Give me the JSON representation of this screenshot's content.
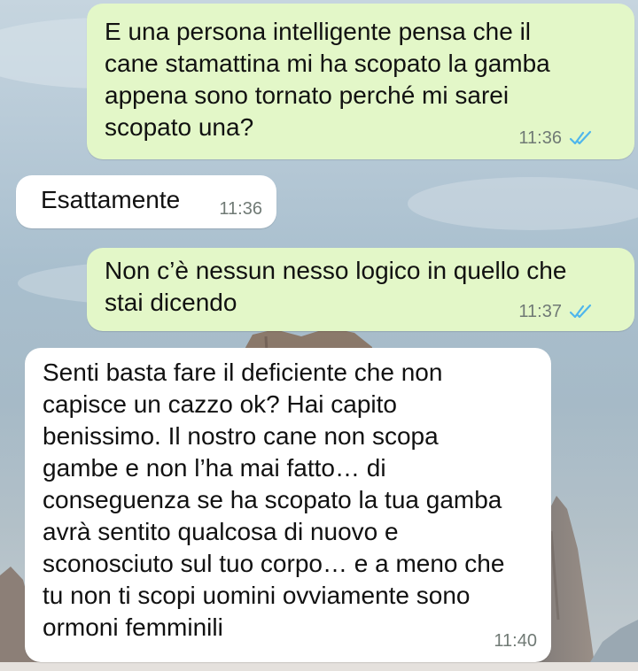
{
  "conversation": {
    "messages": [
      {
        "direction": "outgoing",
        "text": "E una persona intelligente pensa che il\ncane stamattina mi ha scopato la gamba\nappena sono tornato perché mi sarei\nscopato una?",
        "time": "11:36",
        "status": "read"
      },
      {
        "direction": "incoming",
        "text": "Esattamente",
        "time": "11:36"
      },
      {
        "direction": "outgoing",
        "text": "Non c’è nessun nesso logico in quello che\nstai dicendo",
        "time": "11:37",
        "status": "read"
      },
      {
        "direction": "incoming",
        "text": "Senti basta fare il deficiente che non\ncapisce un cazzo ok? Hai capito\nbenissimo. Il nostro cane non scopa\ngambe e non l’ha mai fatto… di\nconseguenza se ha scopato la tua gamba\navrà sentito qualcosa di nuovo e\nsconosciuto sul tuo corpo… e a meno che\ntu non ti scopi uomini ovviamente sono\normoni femminili",
        "time": "11:40"
      }
    ]
  },
  "colors": {
    "outgoing_bubble": "#e3f7c8",
    "incoming_bubble": "#ffffff",
    "read_ticks": "#4fb6ec",
    "timestamp": "#707a75"
  },
  "icons": {
    "read_status": "double-check-icon"
  }
}
